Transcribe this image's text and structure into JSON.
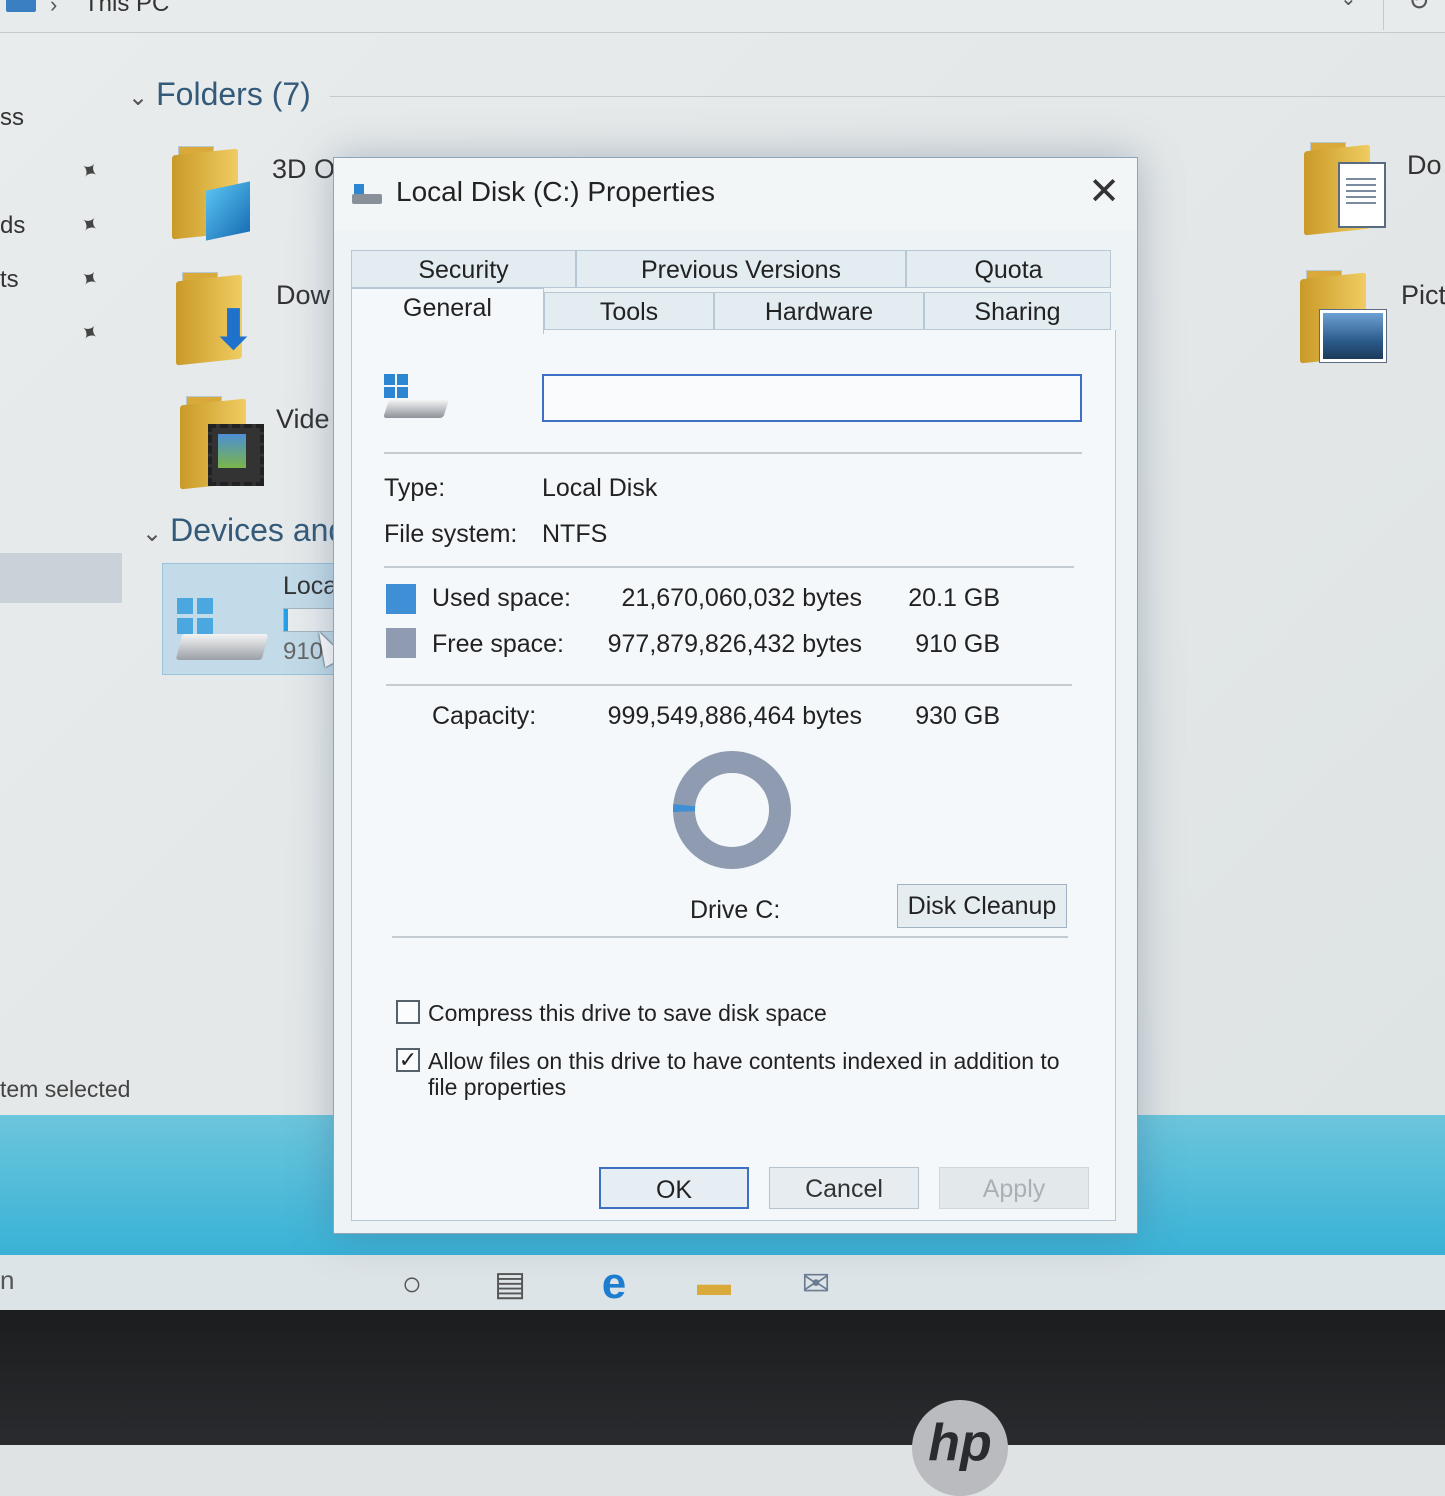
{
  "explorer": {
    "breadcrumb": "This PC",
    "nav_fragments": [
      "ss",
      "ds",
      "ts"
    ],
    "groups": {
      "folders": "Folders (7)",
      "devices": "Devices and"
    },
    "folders": [
      {
        "label": "3D O"
      },
      {
        "label": "Dow"
      },
      {
        "label": "Vide"
      },
      {
        "label": "Do"
      },
      {
        "label": "Pict"
      }
    ],
    "local_disk_tile": {
      "label": "Loca",
      "free": "910"
    },
    "status": "tem selected"
  },
  "dialog": {
    "title": "Local Disk (C:) Properties",
    "close": "✕",
    "tabs_row1": [
      "Security",
      "Previous Versions",
      "Quota"
    ],
    "tabs_row2": [
      "General",
      "Tools",
      "Hardware",
      "Sharing"
    ],
    "label_value": "",
    "type_label": "Type:",
    "type_value": "Local Disk",
    "fs_label": "File system:",
    "fs_value": "NTFS",
    "used": {
      "label": "Used space:",
      "bytes": "21,670,060,032 bytes",
      "size": "20.1 GB",
      "color": "#3f8fd6"
    },
    "free": {
      "label": "Free space:",
      "bytes": "977,879,826,432 bytes",
      "size": "910 GB",
      "color": "#8f9bb0"
    },
    "capacity": {
      "label": "Capacity:",
      "bytes": "999,549,886,464 bytes",
      "size": "930 GB"
    },
    "used_fraction": 0.0217,
    "drive_label": "Drive C:",
    "disk_cleanup": "Disk Cleanup",
    "compress_label": "Compress this drive to save disk space",
    "compress_checked": false,
    "index_label_line1": "Allow files on this drive to have contents indexed in addition to",
    "index_label_line2": "file properties",
    "index_checked": true,
    "buttons": {
      "ok": "OK",
      "cancel": "Cancel",
      "apply": "Apply"
    }
  },
  "taskbar": {
    "left_text": "n"
  },
  "brand": "hp"
}
